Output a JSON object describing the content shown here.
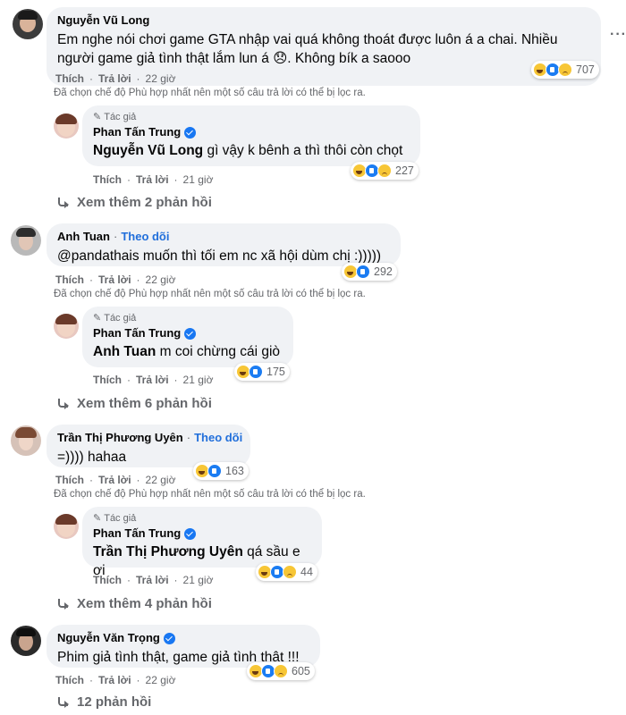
{
  "comments": [
    {
      "author": "Nguyễn Vũ Long",
      "follow": "",
      "text": "Em nghe nói chơi game GTA nhập vai quá không thoát được luôn á a chai. Nhiều người game giả tình thật lắm lun á 😞. Không bík a saooo",
      "reaction_count": "707",
      "like": "Thích",
      "reply": "Trả lời",
      "time": "22 giờ",
      "filter_note": "Đã chọn chế độ Phù hợp nhất nên một số câu trả lời có thể bị lọc ra.",
      "reply_item": {
        "badge": "Tác giả",
        "author": "Phan Tấn Trung",
        "tag": "Nguyễn Vũ Long",
        "text": " gì vậy k bênh a thì thôi còn chọt",
        "reaction_count": "227",
        "like": "Thích",
        "reply": "Trả lời",
        "time": "21 giờ"
      },
      "more_replies": "Xem thêm 2 phản hồi"
    },
    {
      "author": "Anh Tuan",
      "follow": "Theo dõi",
      "text": "@pandathais muốn thì tối em nc xã hội dùm chị :)))))",
      "reaction_count": "292",
      "like": "Thích",
      "reply": "Trả lời",
      "time": "22 giờ",
      "filter_note": "Đã chọn chế độ Phù hợp nhất nên một số câu trả lời có thể bị lọc ra.",
      "reply_item": {
        "badge": "Tác giả",
        "author": "Phan Tấn Trung",
        "tag": "Anh Tuan",
        "text": " m coi chừng cái giò",
        "reaction_count": "175",
        "like": "Thích",
        "reply": "Trả lời",
        "time": "21 giờ"
      },
      "more_replies": "Xem thêm 6 phản hồi"
    },
    {
      "author": "Trần Thị Phương Uyên",
      "follow": "Theo dõi",
      "text": "=)))) hahaa",
      "reaction_count": "163",
      "like": "Thích",
      "reply": "Trả lời",
      "time": "22 giờ",
      "filter_note": "Đã chọn chế độ Phù hợp nhất nên một số câu trả lời có thể bị lọc ra.",
      "reply_item": {
        "badge": "Tác giả",
        "author": "Phan Tấn Trung",
        "tag": "Trần Thị Phương Uyên",
        "text": " qá sầu e ơi",
        "reaction_count": "44",
        "like": "Thích",
        "reply": "Trả lời",
        "time": "21 giờ"
      },
      "more_replies": "Xem thêm 4 phản hồi"
    },
    {
      "author": "Nguyễn Văn Trọng",
      "follow": "",
      "text": "Phim giả tình thật, game giả tình thật !!!",
      "reaction_count": "605",
      "like": "Thích",
      "reply": "Trả lời",
      "time": "22 giờ",
      "more_replies": "12 phản hồi"
    }
  ],
  "colors": {
    "bubble": "#f0f2f5",
    "link": "#216fdb",
    "muted": "#65676b",
    "verified": "#1877f2"
  },
  "icons": [
    "haha-icon",
    "like-icon",
    "sad-icon",
    "verified-icon",
    "reply-arrow-icon",
    "pencil-icon",
    "more-icon"
  ]
}
